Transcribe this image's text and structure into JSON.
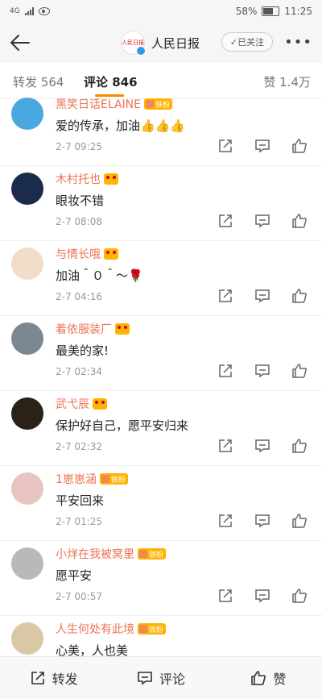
{
  "status_bar": {
    "network": "4G",
    "battery": "58%",
    "time": "11:25",
    "battery_level": 0.58
  },
  "header": {
    "title": "人民日报",
    "logo_text": "人民日报",
    "follow_label": "✓已关注"
  },
  "tabs": {
    "repost": {
      "label": "转发",
      "count": "564"
    },
    "comments": {
      "label": "评论",
      "count": "846"
    },
    "likes": {
      "label": "赞",
      "count": "1.4万"
    }
  },
  "comments": [
    {
      "name": "黑笑日话ELAINE",
      "badge": "fan",
      "text": "爱的传承，加油👍👍👍",
      "time": "2-7 09:25",
      "avatar_color": "#4aa8e0"
    },
    {
      "name": "木村托也",
      "badge": "crown",
      "text": "眼妆不错",
      "time": "2-7 08:08",
      "avatar_color": "#1b2c4a"
    },
    {
      "name": "与情长哦",
      "badge": "crown",
      "text": "加油＾０＾～🌹",
      "time": "2-7 04:16",
      "avatar_color": "#f1dcc8"
    },
    {
      "name": "着依服装厂",
      "badge": "crown",
      "text": "最美的家!",
      "time": "2-7 02:34",
      "avatar_color": "#7d8791"
    },
    {
      "name": "武弋辰",
      "badge": "crown",
      "text": "保护好自己，愿平安归来",
      "time": "2-7 02:32",
      "avatar_color": "#2a2118"
    },
    {
      "name": "1崽崽涵",
      "badge": "fan",
      "text": "平安回来",
      "time": "2-7 01:25",
      "avatar_color": "#e8c4c0"
    },
    {
      "name": "小烊在我被窝里",
      "badge": "fan",
      "text": "愿平安",
      "time": "2-7 00:57",
      "avatar_color": "#b9b9b9"
    },
    {
      "name": "人生何处有此境",
      "badge": "fan",
      "text": "心美，人也美",
      "time": "",
      "avatar_color": "#d9c8a6"
    }
  ],
  "fan_badge_label": "铁粉",
  "bottom_bar": {
    "repost_label": "转发",
    "comment_label": "评论",
    "like_label": "赞"
  },
  "colors": {
    "accent": "#ff8200",
    "username": "#eb7350",
    "badge": "#ffb400"
  },
  "icons": [
    "back-arrow-icon",
    "repost-icon",
    "comment-icon",
    "like-icon",
    "more-icon",
    "verified-icon"
  ]
}
